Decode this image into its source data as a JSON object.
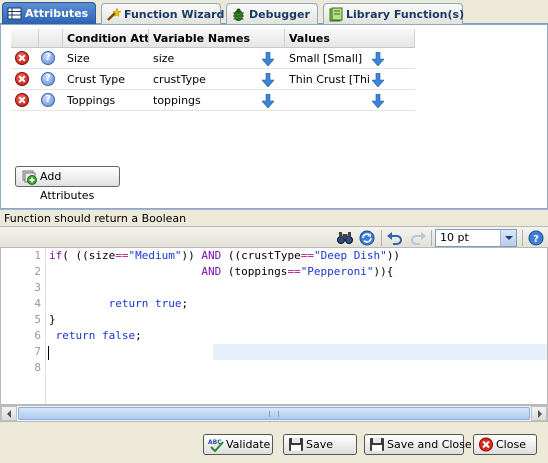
{
  "tabs": [
    {
      "label": "Attributes",
      "icon": "attributes-icon",
      "active": true
    },
    {
      "label": "Function Wizard",
      "icon": "wand-icon",
      "active": false
    },
    {
      "label": "Debugger",
      "icon": "bug-icon",
      "active": false
    },
    {
      "label": "Library Function(s)",
      "icon": "library-icon",
      "active": false
    }
  ],
  "grid": {
    "columns": [
      "Condition Att...",
      "Variable Names",
      "Values"
    ],
    "rows": [
      {
        "attribute": "Size",
        "variable": "size",
        "value": "Small [Small]"
      },
      {
        "attribute": "Crust Type",
        "variable": "crustType",
        "value": "Thin Crust [Thi..."
      },
      {
        "attribute": "Toppings",
        "variable": "toppings",
        "value": ""
      }
    ]
  },
  "add_attributes_label": "Add Attributes",
  "function_label": "Function should return a Boolean",
  "toolbar": {
    "font_size": "10 pt"
  },
  "code": {
    "line_numbers": [
      "1",
      "2",
      "3",
      "4",
      "5",
      "6",
      "7",
      "8"
    ],
    "lines": [
      "if( ((size==\"Medium\")) AND ((crustType==\"Deep Dish\"))",
      "                       AND (toppings==\"Pepperoni\")){",
      "",
      "         return true;",
      "}",
      " return false;",
      "",
      ""
    ]
  },
  "buttons": {
    "validate": "Validate",
    "save": "Save",
    "save_close": "Save and Close",
    "close": "Close"
  },
  "colors": {
    "tab_active": "#2c62b3",
    "keyword": "#7a0fb0",
    "string": "#1a36d4",
    "operator": "#b2168a"
  }
}
